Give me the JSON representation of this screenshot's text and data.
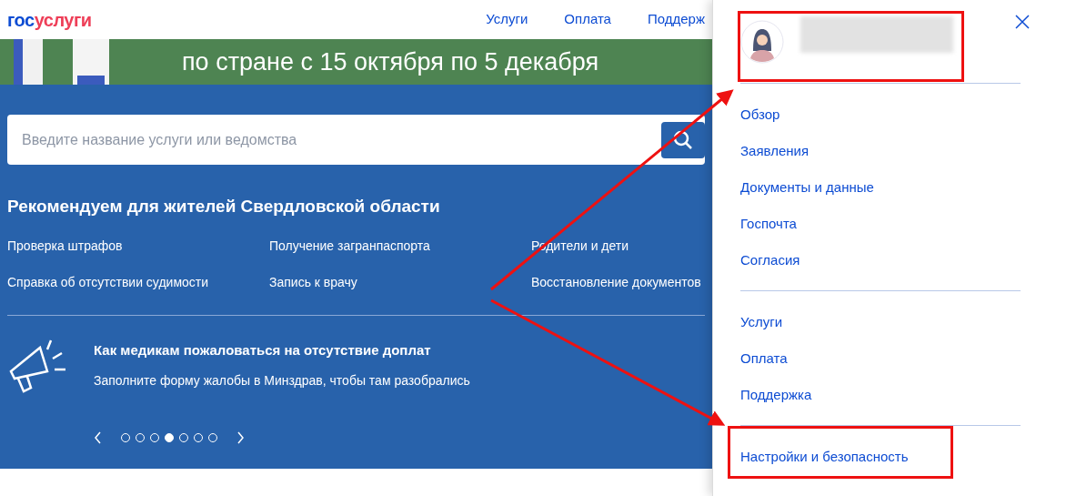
{
  "header": {
    "logo": {
      "prefix": "гос",
      "suffix": "услуги"
    },
    "nav": [
      "Услуги",
      "Оплата",
      "Поддерж"
    ]
  },
  "banner": {
    "text": "по стране с 15 октября по 5 декабря"
  },
  "search": {
    "placeholder": "Введите название услуги или ведомства"
  },
  "recommend": {
    "title": "Рекомендуем для жителей Свердловской области",
    "links": [
      "Проверка штрафов",
      "Получение загранпаспорта",
      "Родители и дети",
      "Справка об отсутствии судимости",
      "Запись к врачу",
      "Восстановление документов"
    ]
  },
  "news": {
    "title": "Как медикам пожаловаться на отсутствие доплат",
    "text": "Заполните форму жалобы в Минздрав, чтобы там разобрались",
    "dots": [
      {
        "selected": false
      },
      {
        "selected": false
      },
      {
        "selected": false
      },
      {
        "selected": true
      },
      {
        "selected": false
      },
      {
        "selected": false
      },
      {
        "selected": false
      }
    ]
  },
  "drawer": {
    "groups": [
      [
        "Обзор",
        "Заявления",
        "Документы и данные",
        "Госпочта",
        "Согласия"
      ],
      [
        "Услуги",
        "Оплата",
        "Поддержка"
      ],
      [
        "Настройки и безопасность"
      ]
    ]
  }
}
